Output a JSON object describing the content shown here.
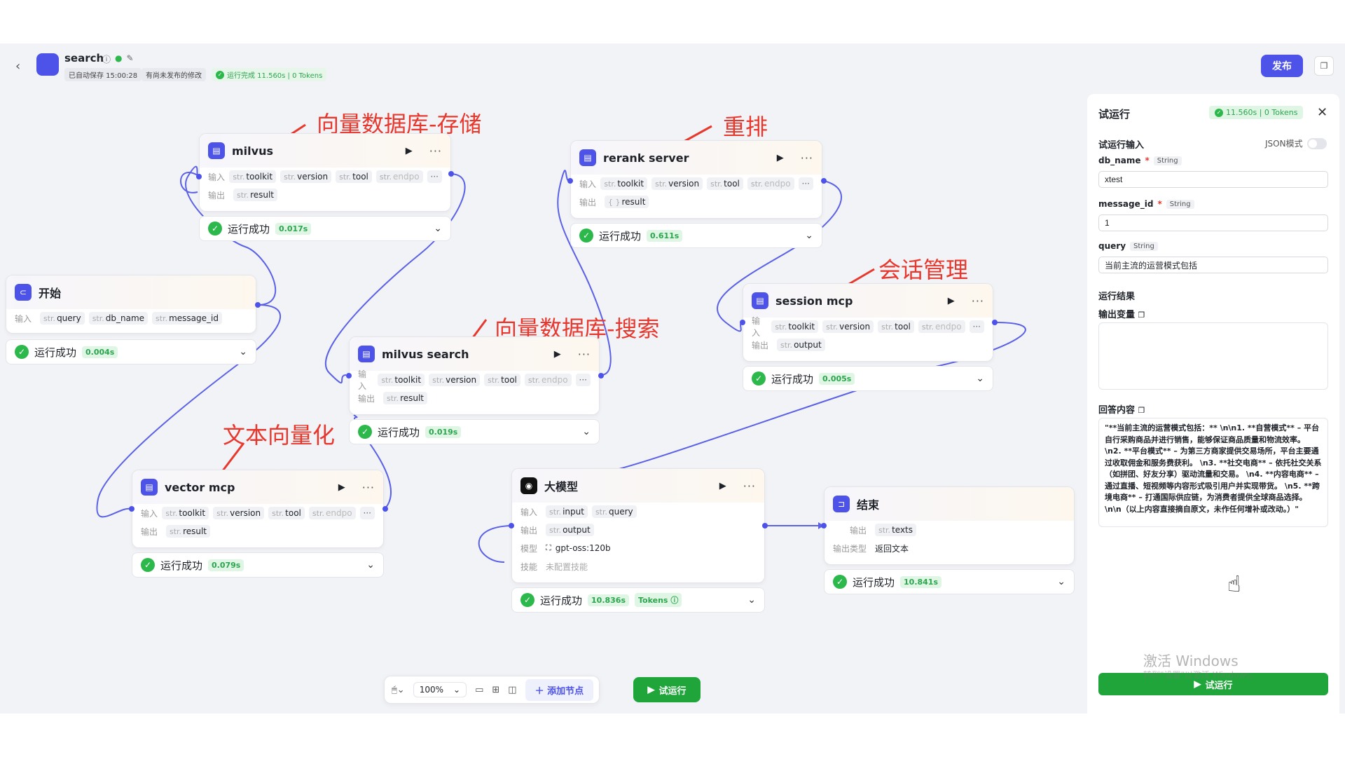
{
  "header": {
    "app_title": "search",
    "autosave": "已自动保存 15:00:28",
    "unpublished": "有尚未发布的修改",
    "run_status": "运行完成 11.560s | 0 Tokens",
    "publish_label": "发布"
  },
  "nodes": {
    "milvus": {
      "title": "milvus",
      "in_label": "输入",
      "out_label": "输出",
      "inputs": [
        "toolkit",
        "version",
        "tool",
        "endpo"
      ],
      "output": "result",
      "status": "运行成功",
      "time": "0.017s"
    },
    "rerank": {
      "title": "rerank server",
      "in_label": "输入",
      "out_label": "输出",
      "inputs": [
        "toolkit",
        "version",
        "tool",
        "endpo"
      ],
      "output": "result",
      "status": "运行成功",
      "time": "0.611s"
    },
    "start": {
      "title": "开始",
      "in_label": "输入",
      "inputs": [
        "query",
        "db_name",
        "message_id"
      ],
      "status": "运行成功",
      "time": "0.004s"
    },
    "session": {
      "title": "session mcp",
      "in_label": "输入",
      "out_label": "输出",
      "inputs": [
        "toolkit",
        "version",
        "tool",
        "endpo"
      ],
      "output": "output",
      "status": "运行成功",
      "time": "0.005s"
    },
    "milvus_search": {
      "title": "milvus search",
      "in_label": "输入",
      "out_label": "输出",
      "inputs": [
        "toolkit",
        "version",
        "tool",
        "endpo"
      ],
      "output": "result",
      "status": "运行成功",
      "time": "0.019s"
    },
    "vector": {
      "title": "vector mcp",
      "in_label": "输入",
      "out_label": "输出",
      "inputs": [
        "toolkit",
        "version",
        "tool",
        "endpo"
      ],
      "output": "result",
      "status": "运行成功",
      "time": "0.079s"
    },
    "llm": {
      "title": "大模型",
      "in_label": "输入",
      "out_label": "输出",
      "model_label": "模型",
      "skill_label": "技能",
      "inputs": [
        "input",
        "query"
      ],
      "output": "output",
      "model": "gpt-oss:120b",
      "skill": "未配置技能",
      "status": "运行成功",
      "time": "10.836s",
      "tokens": "Tokens"
    },
    "end": {
      "title": "结束",
      "out_label": "输出",
      "type_label": "输出类型",
      "output": "texts",
      "type_value": "返回文本",
      "status": "运行成功",
      "time": "10.841s"
    }
  },
  "annotations": {
    "store": "向量数据库-存储",
    "rerank": "重排",
    "session": "会话管理",
    "search": "向量数据库-搜索",
    "vectorize": "文本向量化"
  },
  "toolbar": {
    "zoom": "100%",
    "add_node": "添加节点",
    "trial_run": "试运行"
  },
  "panel": {
    "title": "试运行",
    "badge": "11.560s | 0 Tokens",
    "input_section": "试运行输入",
    "json_mode": "JSON模式",
    "fields": [
      {
        "name": "db_name",
        "required": true,
        "type": "String",
        "value": "xtest"
      },
      {
        "name": "message_id",
        "required": true,
        "type": "String",
        "value": "1"
      },
      {
        "name": "query",
        "required": false,
        "type": "String",
        "value": "当前主流的运营模式包括"
      }
    ],
    "result_section": "运行结果",
    "output_var": "输出变量",
    "answer_label": "回答内容",
    "answer_text": "\"**当前主流的运营模式包括：** \\n\\n1. **自营模式** – 平台自行采购商品并进行销售，能够保证商品质量和物流效率。 \\n2. **平台模式** – 为第三方商家提供交易场所，平台主要通过收取佣金和服务费获利。 \\n3. **社交电商** – 依托社交关系（如拼团、好友分享）驱动流量和交易。 \\n4. **内容电商** – 通过直播、短视频等内容形式吸引用户并实现带货。 \\n5. **跨境电商** – 打通国际供应链，为消费者提供全球商品选择。 \\n\\n（以上内容直接摘自原文，未作任何增补或改动。）\"",
    "run_label": "试运行"
  },
  "watermark": {
    "line1": "激活 Windows",
    "line2": "转到\"设置\"以激活 Windows。"
  },
  "colors": {
    "accent": "#4d53e8",
    "success": "#2db84c",
    "annotation": "#e8382d"
  }
}
